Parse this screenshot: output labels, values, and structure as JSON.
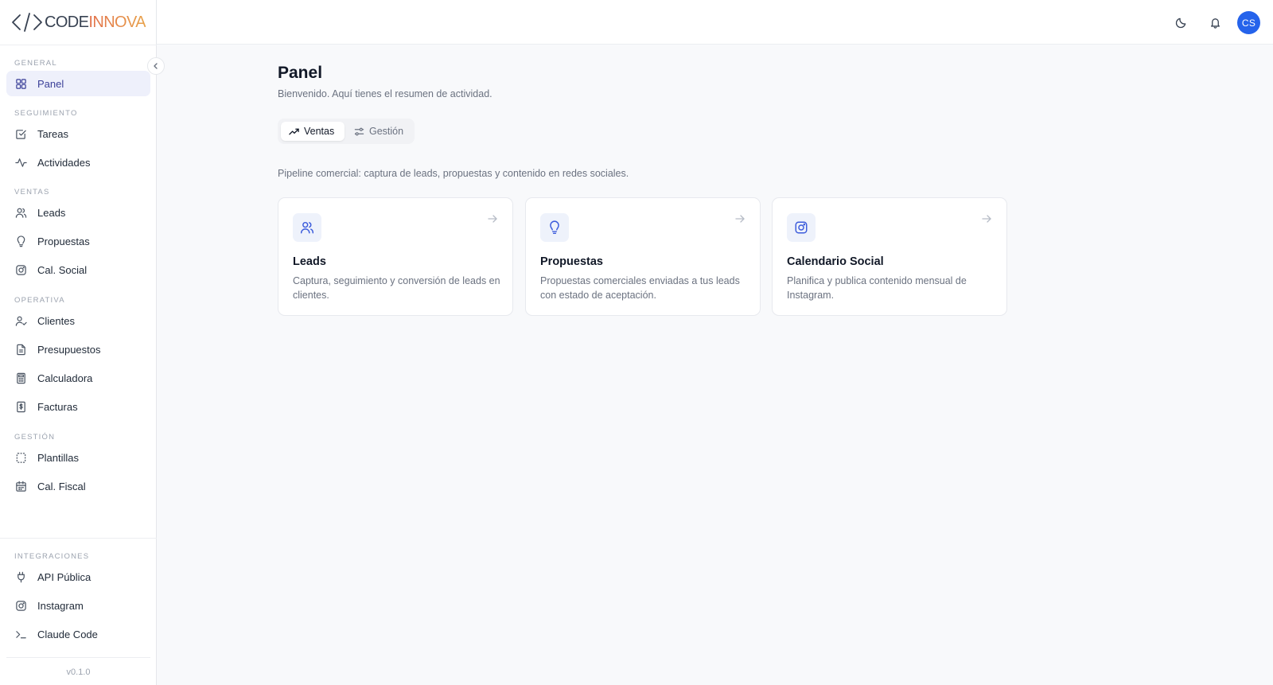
{
  "brand": {
    "code": "CODE",
    "innova": "INNOVA"
  },
  "sidebar": {
    "sections": [
      {
        "label": "GENERAL"
      },
      {
        "label": "SEGUIMIENTO"
      },
      {
        "label": "VENTAS"
      },
      {
        "label": "OPERATIVA"
      },
      {
        "label": "GESTIÓN"
      },
      {
        "label": "INTEGRACIONES"
      }
    ],
    "items": [
      {
        "label": "Panel",
        "icon": "grid-icon"
      },
      {
        "label": "Tareas",
        "icon": "check-square-icon"
      },
      {
        "label": "Actividades",
        "icon": "activity-icon"
      },
      {
        "label": "Leads",
        "icon": "users-icon"
      },
      {
        "label": "Propuestas",
        "icon": "lightbulb-icon"
      },
      {
        "label": "Cal. Social",
        "icon": "instagram-icon"
      },
      {
        "label": "Clientes",
        "icon": "user-check-icon"
      },
      {
        "label": "Presupuestos",
        "icon": "file-icon"
      },
      {
        "label": "Calculadora",
        "icon": "calculator-icon"
      },
      {
        "label": "Facturas",
        "icon": "receipt-icon"
      },
      {
        "label": "Plantillas",
        "icon": "template-icon"
      },
      {
        "label": "Cal. Fiscal",
        "icon": "calendar-icon"
      },
      {
        "label": "API Pública",
        "icon": "plug-icon"
      },
      {
        "label": "Instagram",
        "icon": "instagram-icon"
      },
      {
        "label": "Claude Code",
        "icon": "terminal-icon"
      }
    ],
    "version": "v0.1.0"
  },
  "header": {
    "avatar_initials": "CS"
  },
  "main": {
    "title": "Panel",
    "subtitle": "Bienvenido. Aquí tienes el resumen de actividad.",
    "tabs": [
      {
        "label": "Ventas",
        "icon": "trending-up-icon"
      },
      {
        "label": "Gestión",
        "icon": "sliders-icon"
      }
    ],
    "pipeline_text": "Pipeline comercial: captura de leads, propuestas y contenido en redes sociales.",
    "cards": [
      {
        "title": "Leads",
        "description": "Captura, seguimiento y conversión de leads en clientes.",
        "icon": "users-icon"
      },
      {
        "title": "Propuestas",
        "description": "Propuestas comerciales enviadas a tus leads con estado de aceptación.",
        "icon": "lightbulb-icon"
      },
      {
        "title": "Calendario Social",
        "description": "Planifica y publica contenido mensual de Instagram.",
        "icon": "instagram-icon"
      }
    ]
  },
  "colors": {
    "accent": "#2563eb",
    "active_nav_bg": "#eef0fb",
    "active_nav_text": "#3a3f98"
  }
}
